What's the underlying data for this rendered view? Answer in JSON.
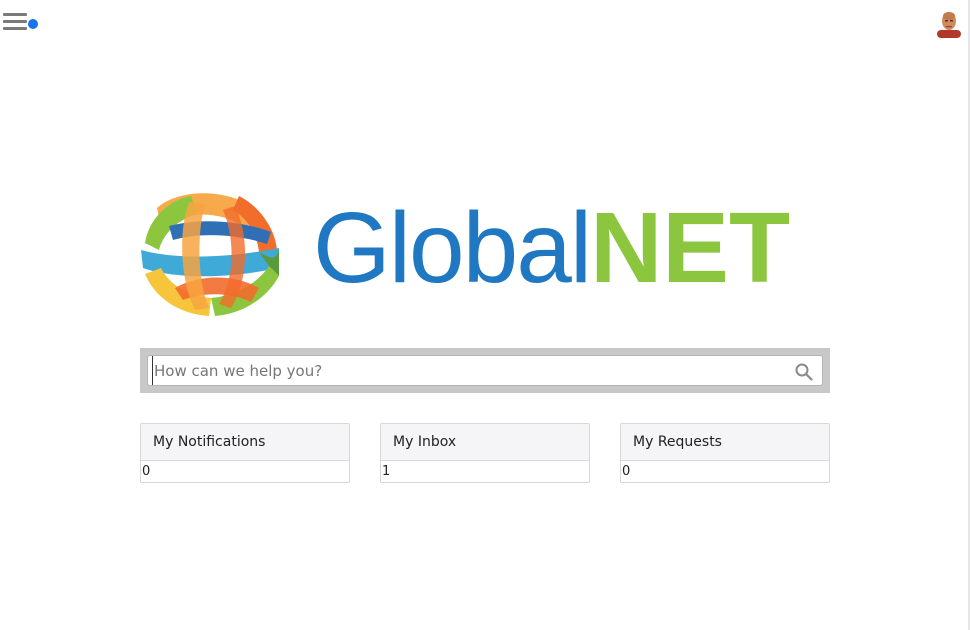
{
  "header": {
    "menu_icon": "hamburger-menu-icon",
    "notification_dot_color": "#1a73e8",
    "avatar_icon": "user-avatar"
  },
  "logo": {
    "text_part1": "Global",
    "text_part2": "NET",
    "color_part1": "#1f78c1",
    "color_part2": "#8cc63f"
  },
  "search": {
    "placeholder": "How can we help you?",
    "value": "",
    "icon": "search-icon"
  },
  "cards": [
    {
      "title": "My Notifications",
      "value": "0"
    },
    {
      "title": "My Inbox",
      "value": "1"
    },
    {
      "title": "My Requests",
      "value": "0"
    }
  ]
}
